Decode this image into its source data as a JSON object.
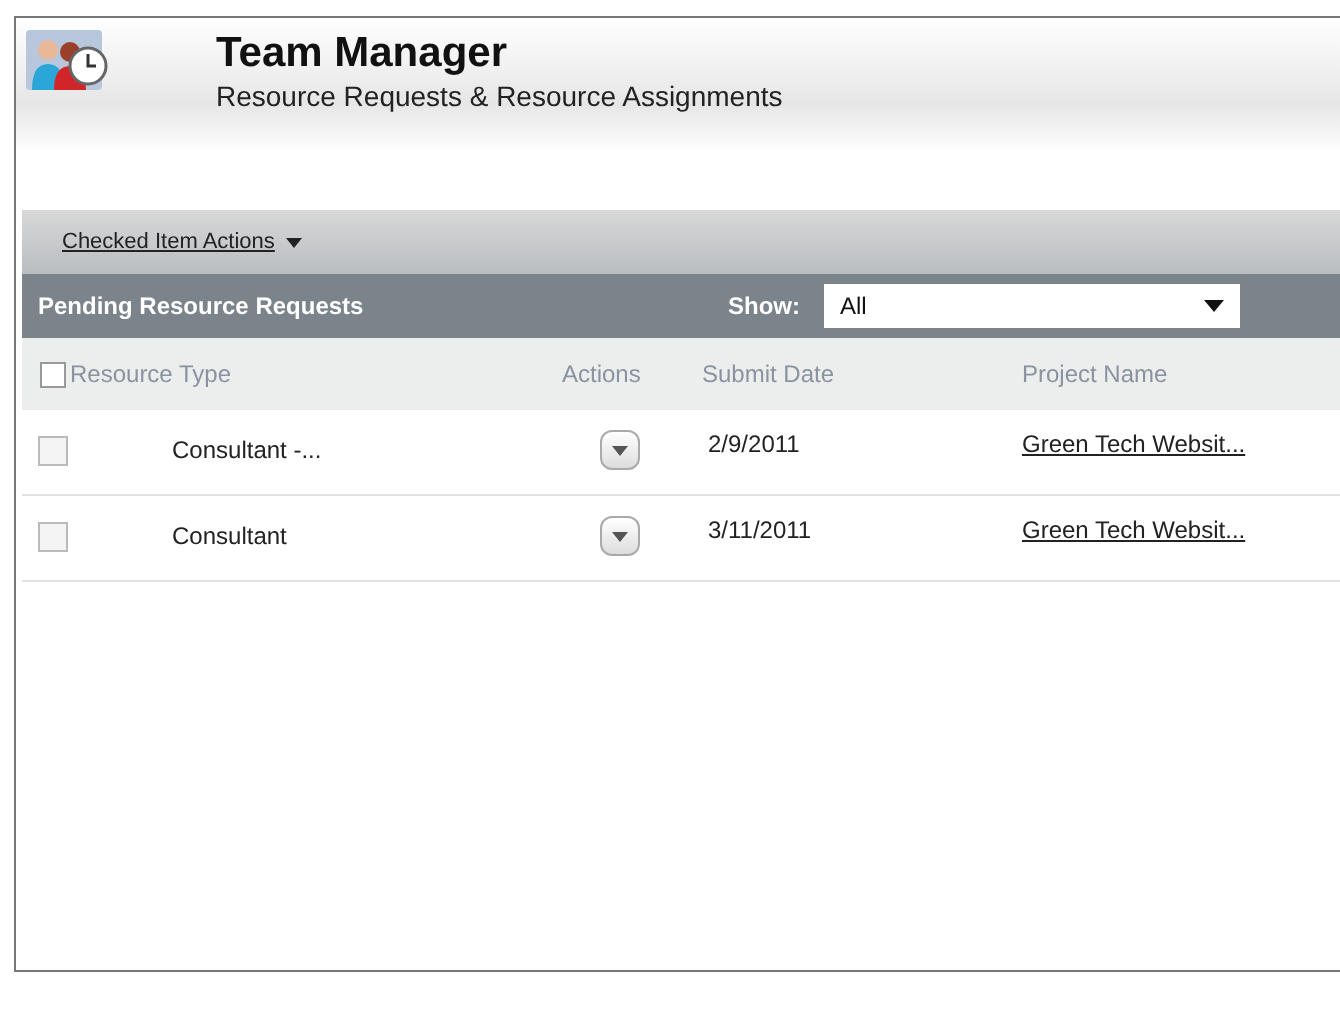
{
  "header": {
    "title": "Team Manager",
    "subtitle": "Resource Requests & Resource Assignments"
  },
  "toolbar": {
    "actions_menu": "Checked Item Actions"
  },
  "panel": {
    "title": "Pending Resource Requests",
    "filter": {
      "label": "Show:",
      "value": "All"
    }
  },
  "table": {
    "select_all": {
      "checked": false
    },
    "columns": [
      "Resource Type",
      "Actions",
      "Submit Date",
      "Project Name"
    ],
    "rows": [
      {
        "checked": false,
        "resource_type": "Consultant -...",
        "submit_date": "2/9/2011",
        "project_name": "Green Tech Websit..."
      },
      {
        "checked": false,
        "resource_type": "Consultant",
        "submit_date": "3/11/2011",
        "project_name": "Green Tech Websit..."
      }
    ]
  }
}
